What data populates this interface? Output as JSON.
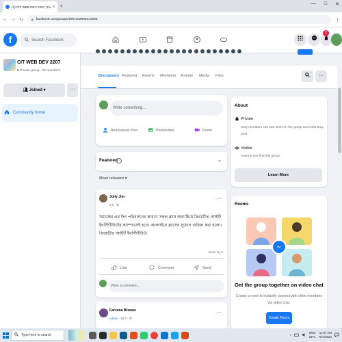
{
  "browser": {
    "tab_title": "(2) CIT WEB DEV 2207 | Facebook",
    "tab_close": "x",
    "new_tab": "+",
    "url": "facebook.com/groups/1987302998134596",
    "window_controls": [
      "—",
      "□",
      "✕"
    ]
  },
  "header": {
    "logo": "f",
    "search_placeholder": "Search Facebook",
    "notification_count": "2"
  },
  "group": {
    "name": "CIT WEB DEV 2207",
    "meta": "Private group · 25 members",
    "joined_label": "Joined",
    "more_label": "···",
    "community_home": "Community home"
  },
  "tabs": [
    {
      "label": "Discussion"
    },
    {
      "label": "Featured"
    },
    {
      "label": "Rooms"
    },
    {
      "label": "Members"
    },
    {
      "label": "Events"
    },
    {
      "label": "Media"
    },
    {
      "label": "Files"
    }
  ],
  "composer": {
    "placeholder": "Write something...",
    "actions": [
      {
        "label": "Anonymous Post",
        "icon": "anonymous-post-icon",
        "color": "#1877f2"
      },
      {
        "label": "Photo/video",
        "icon": "photo-icon",
        "color": "#45bd62"
      },
      {
        "label": "Room",
        "icon": "room-icon",
        "color": "#a033ff"
      }
    ]
  },
  "featured": {
    "label": "Featured",
    "info": "i",
    "chevron": "⌄"
  },
  "sort_label": "Most relevant",
  "post": {
    "author": "Jolly Jim",
    "time": "3 h · ⚙",
    "text": "সমাজের এর দিন পরিবর্তনের কারণে সকল ক্লাস অব্যাহিয়ে ক্রিয়েটিভ আইটি ইনস্টিটিউটের ক্যাম্পাসেই হবে। অনলাইনে ক্লাসের সুযোগ বাতিল করা হলো। ক্রিয়েটিভ আইটি ইনস্টিটিউট।",
    "seen_by": "Seen by 3",
    "actions": [
      "Like",
      "Comment",
      "Send"
    ],
    "comment_placeholder": "Write a comment..."
  },
  "post2": {
    "author": "Farzana Biswas",
    "badge": "Admin",
    "time": "· 16 h · ⚙"
  },
  "about": {
    "title": "About",
    "private_title": "Private",
    "private_desc": "Only members can see who's in the group and what they post.",
    "visible_title": "Visible",
    "visible_desc": "Anyone can find this group.",
    "learn_more": "Learn More"
  },
  "rooms": {
    "title": "Rooms",
    "headline": "Get the group together on video chat",
    "desc": "Create a room to instantly connect with other members via video chat.",
    "create_label": "Create Room"
  },
  "taskbar": {
    "search_placeholder": "Type here to search",
    "lang": "ENG",
    "lang2": "INTL",
    "time": "11:07 AM",
    "date": "7/27/2023"
  }
}
